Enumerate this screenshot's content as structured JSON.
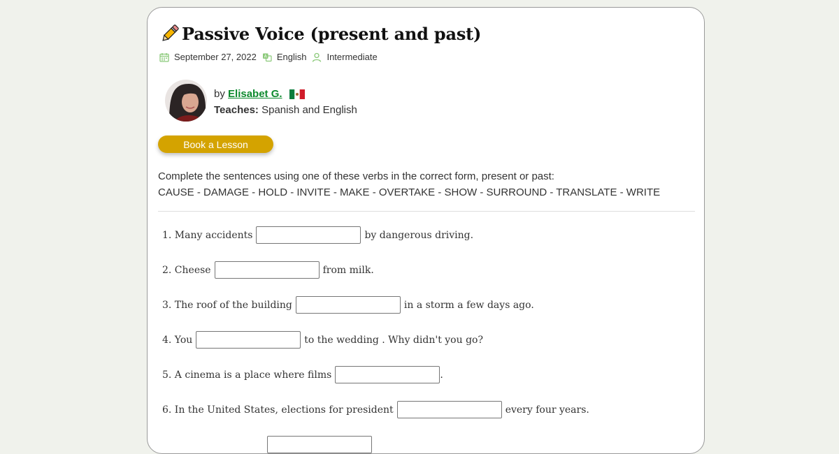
{
  "title": "Passive Voice (present and past)",
  "meta": {
    "date": "September 27, 2022",
    "language": "English",
    "level": "Intermediate"
  },
  "author": {
    "by": "by",
    "name": "Elisabet G.",
    "teaches_label": "Teaches:",
    "teaches_value": "Spanish and English"
  },
  "book_button": "Book a Lesson",
  "instructions": {
    "line1": "Complete the sentences using one of these verbs in the correct form, present or past:",
    "line2": "CAUSE - DAMAGE - HOLD - INVITE - MAKE - OVERTAKE - SHOW - SURROUND - TRANSLATE - WRITE"
  },
  "questions": [
    {
      "before": "1. Many accidents",
      "after": "by dangerous driving.",
      "value": ""
    },
    {
      "before": "2. Cheese",
      "after": "from milk.",
      "value": ""
    },
    {
      "before": "3. The roof of the building",
      "after": "in a storm a few days ago.",
      "value": ""
    },
    {
      "before": "4. You",
      "after": "to the wedding . Why didn't you go?",
      "value": ""
    },
    {
      "before": "5. A cinema is a place where films",
      "after": ".",
      "value": ""
    },
    {
      "before": "6. In the United States, elections for president",
      "after": "every four years.",
      "value": ""
    }
  ],
  "colors": {
    "accent_green": "#0d8a2e",
    "button": "#d4a300",
    "icon_green": "#8bc97a"
  }
}
